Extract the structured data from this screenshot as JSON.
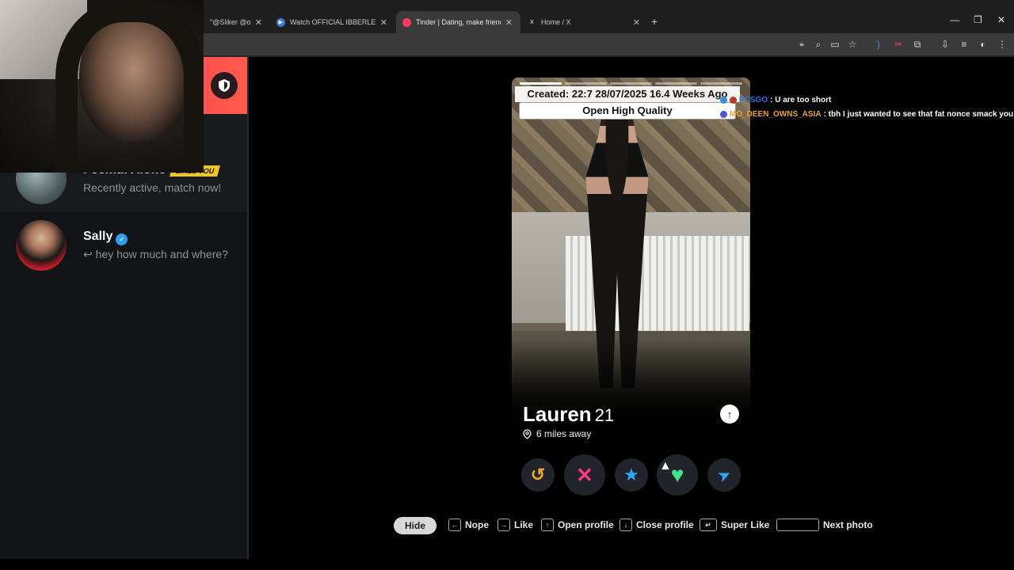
{
  "browser": {
    "tabs": [
      {
        "title": "\"@Sliker @oatn",
        "favicon": "",
        "active": false
      },
      {
        "title": "Watch OFFICIAL IBBERLEFT SOUT",
        "favicon": "",
        "active": false
      },
      {
        "title": "Tinder | Dating, make friends &",
        "favicon": "",
        "active": true
      },
      {
        "title": "Home / X",
        "favicon": "X",
        "active": false
      }
    ],
    "new_tab": "+",
    "window_controls": [
      "—",
      "❐",
      "✕"
    ]
  },
  "sidebar": {
    "matches": [
      {
        "name": "Feemul Alone",
        "badge": "LIKES YOU",
        "subtitle": "Recently active, match now!",
        "online": true
      },
      {
        "name": "Sally",
        "subtitle": "hey how much and where?",
        "reply_arrow": "↩",
        "verified": true
      }
    ]
  },
  "overlay": {
    "created": "Created: 22:7 28/07/2025 16.4 Weeks Ago",
    "open_hq": "Open High Quality"
  },
  "profile": {
    "name": "Lauren",
    "age": "21",
    "distance": "6 miles away"
  },
  "actions": {
    "rewind": "↺",
    "nope": "✕",
    "superlike": "★",
    "like": "♥",
    "boost": "➤"
  },
  "hints": {
    "hide": "Hide",
    "nope": "Nope",
    "like": "Like",
    "open_profile": "Open profile",
    "close_profile": "Close profile",
    "super_like": "Super Like",
    "next_photo": "Next photo"
  },
  "chat": [
    {
      "user": "PCSGO",
      "message": ": U are too short",
      "color": "#2f6fe0"
    },
    {
      "user": "MO_DEEN_OWNS_ASIA",
      "message": ": tbh I just wanted to see that fat nonce smack you up",
      "color": "#e8a33c"
    }
  ],
  "colors": {
    "tinder_gradient_start": "#fd2a63",
    "tinder_gradient_end": "#fe5b4b",
    "rewind": "#f5a623",
    "nope": "#ff3a83",
    "superlike": "#2ea8ff",
    "like": "#3ee58a",
    "boost": "#2fa2ff"
  }
}
